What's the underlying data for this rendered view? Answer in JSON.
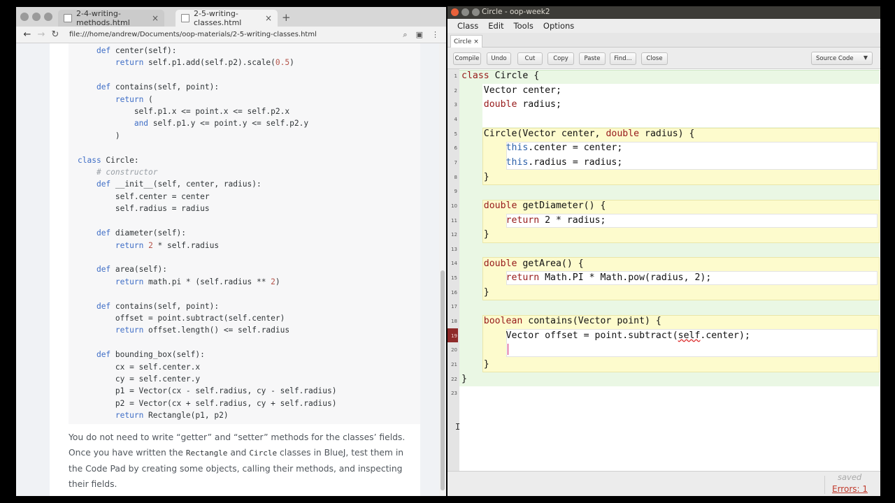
{
  "browser": {
    "tabs": [
      {
        "label": "2-4-writing-methods.html",
        "active": false
      },
      {
        "label": "2-5-writing-classes.html",
        "active": true
      }
    ],
    "new_tab": "+",
    "close_glyph": "×",
    "url": "file:///home/andrew/Documents/oop-materials/2-5-writing-classes.html",
    "nav": {
      "back": "←",
      "forward": "→",
      "reload": "↻"
    },
    "toolbar_icons": [
      "zoom-icon",
      "account-icon",
      "menu-icon"
    ]
  },
  "page": {
    "code_lines": [
      "    def center(self):",
      "        return self.p1.add(self.p2).scale(0.5)",
      "",
      "    def contains(self, point):",
      "        return (",
      "            self.p1.x <= point.x <= self.p2.x",
      "            and self.p1.y <= point.y <= self.p2.y",
      "        )",
      "",
      "class Circle:",
      "    # constructor",
      "    def __init__(self, center, radius):",
      "        self.center = center",
      "        self.radius = radius",
      "",
      "    def diameter(self):",
      "        return 2 * self.radius",
      "",
      "    def area(self):",
      "        return math.pi * (self.radius ** 2)",
      "",
      "    def contains(self, point):",
      "        offset = point.subtract(self.center)",
      "        return offset.length() <= self.radius",
      "",
      "    def bounding_box(self):",
      "        cx = self.center.x",
      "        cy = self.center.y",
      "        p1 = Vector(cx - self.radius, cy - self.radius)",
      "        p2 = Vector(cx + self.radius, cy + self.radius)",
      "        return Rectangle(p1, p2)"
    ],
    "prose": {
      "part1": "You do not need to write “getter” and “setter” methods for the classes’ fields. Once you have written the ",
      "code1": "Rectangle",
      "part2": " and ",
      "code2": "Circle",
      "part3": " classes in BlueJ, test them in the Code Pad by creating some objects, calling their methods, and inspecting their fields."
    }
  },
  "editor": {
    "title": "Circle - oop-week2",
    "menu": [
      "Class",
      "Edit",
      "Tools",
      "Options"
    ],
    "tab_label": "Circle",
    "tab_close": "×",
    "buttons": [
      "Compile",
      "Undo",
      "Cut",
      "Copy",
      "Paste",
      "Find...",
      "Close"
    ],
    "view_select": "Source Code",
    "line_numbers": [
      "1",
      "2",
      "3",
      "4",
      "5",
      "6",
      "7",
      "8",
      "9",
      "10",
      "11",
      "12",
      "13",
      "14",
      "15",
      "16",
      "17",
      "18",
      "19",
      "20",
      "21",
      "22",
      "23"
    ],
    "code_lines": [
      "class Circle {",
      "    Vector center;",
      "    double radius;",
      "",
      "    Circle(Vector center, double radius) {",
      "        this.center = center;",
      "        this.radius = radius;",
      "    }",
      "",
      "    double getDiameter() {",
      "        return 2 * radius;",
      "    }",
      "",
      "    double getArea() {",
      "        return Math.PI * Math.pow(radius, 2);",
      "    }",
      "",
      "    boolean contains(Vector point) {",
      "        Vector offset = point.subtract(self.center);",
      "",
      "    }",
      "}",
      ""
    ],
    "status_saved": "saved",
    "status_errors": "Errors: 1"
  }
}
